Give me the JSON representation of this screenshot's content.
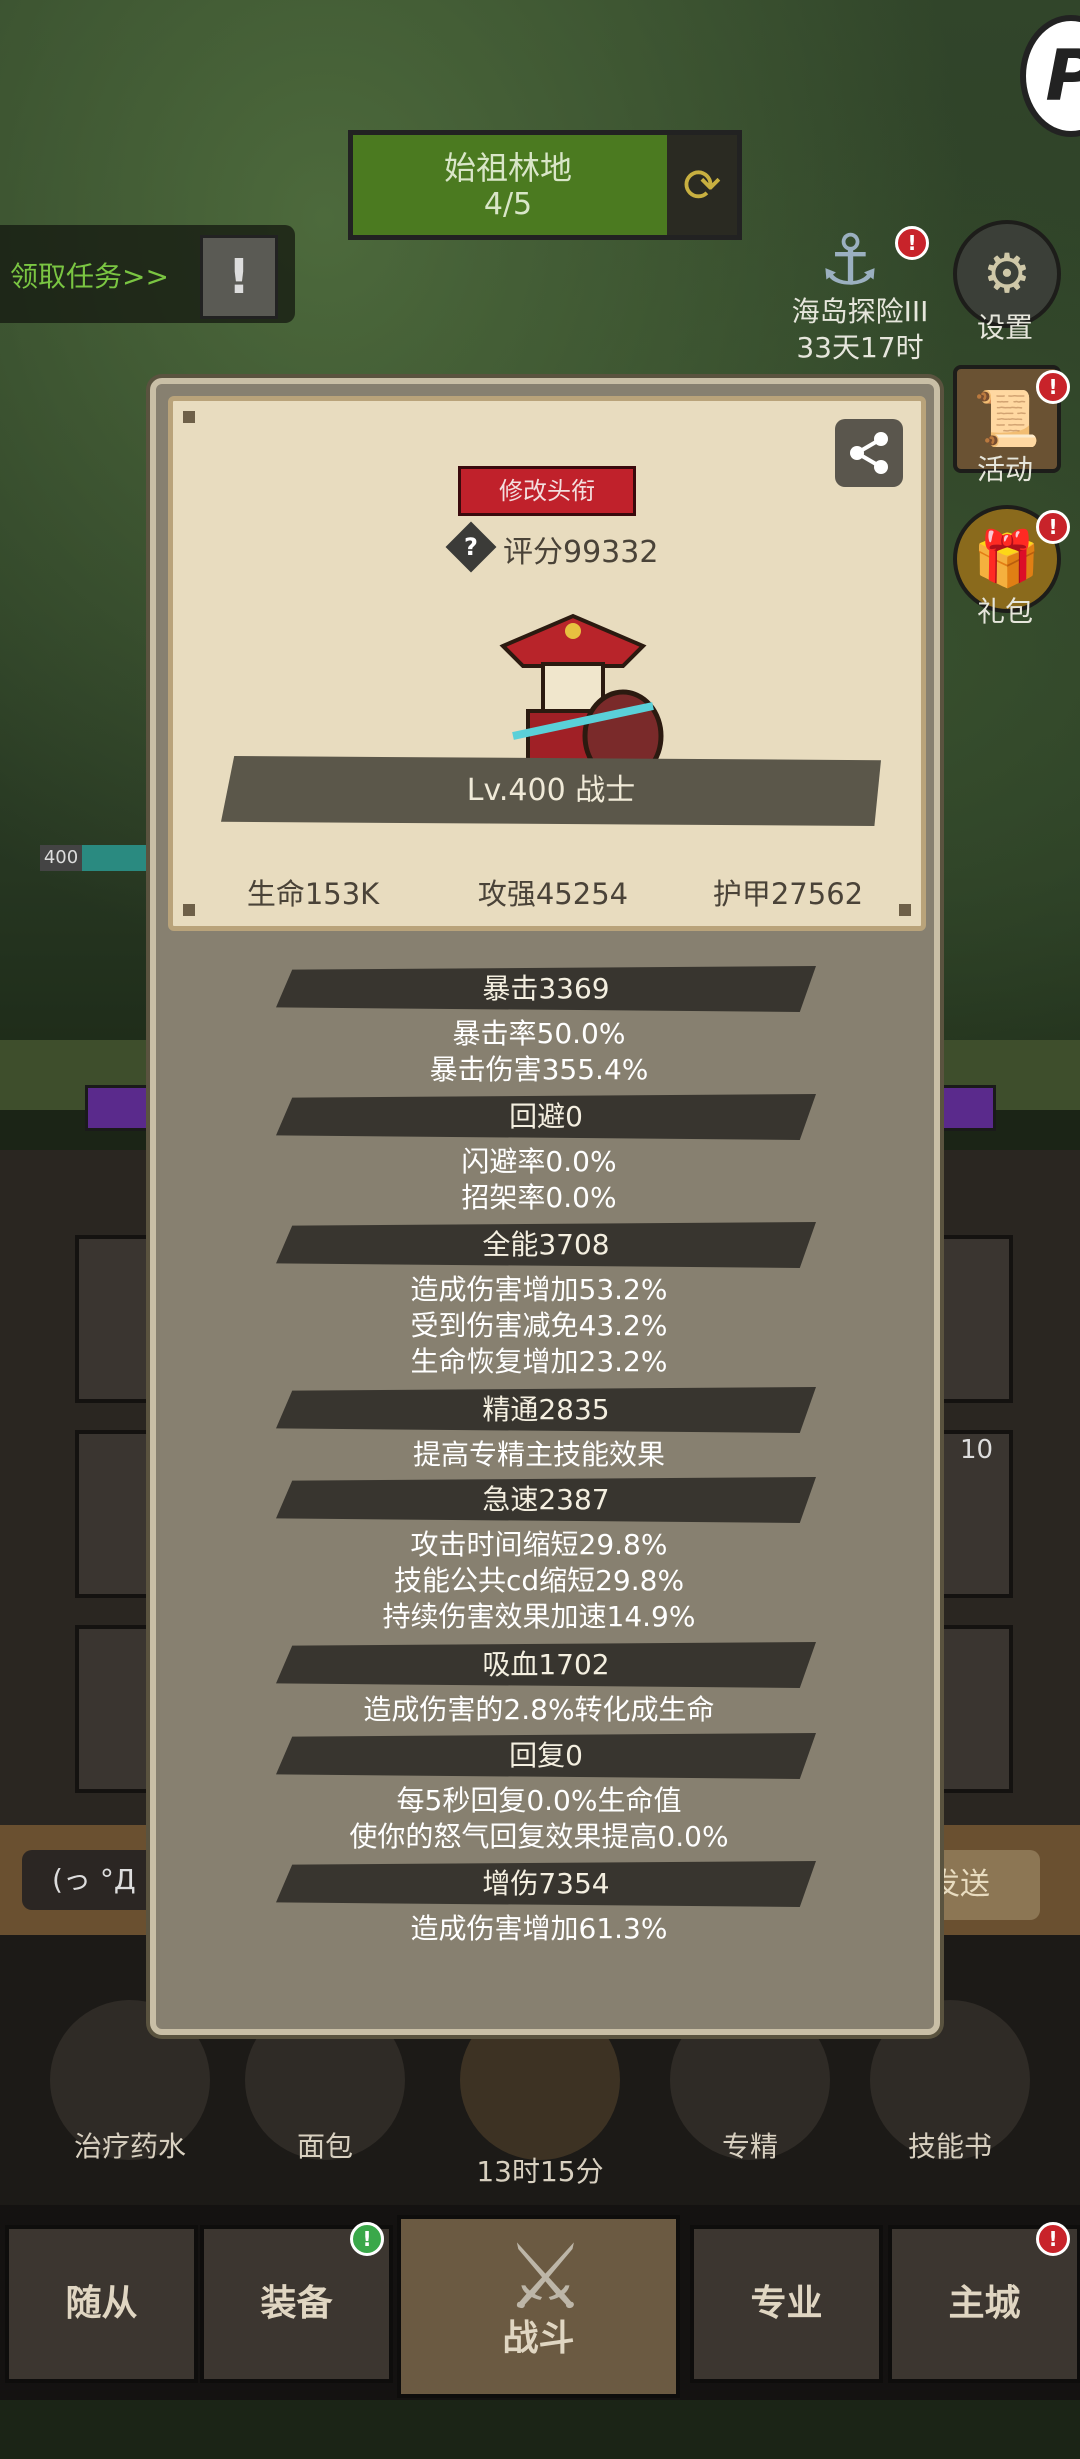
{
  "top_hud": {
    "region_name": "始祖林地",
    "region_progress": "4/5",
    "quest_label": "领取任务>>",
    "quest_icon": "!"
  },
  "side_menu": [
    {
      "label": "海岛探险III",
      "sub": "33天17时",
      "icon": "anchor-icon"
    },
    {
      "label": "设置",
      "icon": "gear-icon"
    },
    {
      "label": "活动",
      "icon": "scroll-icon"
    },
    {
      "label": "礼包",
      "icon": "gift-icon"
    }
  ],
  "profile": {
    "title_button": "修改头衔",
    "score": "评分99332",
    "level_class": "Lv.400 战士",
    "stats": [
      "生命153K",
      "攻强45254",
      "护甲27562"
    ]
  },
  "sections": [
    {
      "title": "暴击3369",
      "lines": [
        "暴击率50.0%",
        "暴击伤害355.4%"
      ]
    },
    {
      "title": "回避0",
      "lines": [
        "闪避率0.0%",
        "招架率0.0%"
      ]
    },
    {
      "title": "全能3708",
      "lines": [
        "造成伤害增加53.2%",
        "受到伤害减免43.2%",
        "生命恢复增加23.2%"
      ]
    },
    {
      "title": "精通2835",
      "lines": [
        "提高专精主技能效果"
      ]
    },
    {
      "title": "急速2387",
      "lines": [
        "攻击时间缩短29.8%",
        "技能公共cd缩短29.8%",
        "持续伤害效果加速14.9%"
      ]
    },
    {
      "title": "吸血1702",
      "lines": [
        "造成伤害的2.8%转化成生命"
      ]
    },
    {
      "title": "回复0",
      "lines": [
        "每5秒回复0.0%生命值",
        "使你的怒气回复效果提高0.0%"
      ]
    },
    {
      "title": "增伤7354",
      "lines": [
        "造成伤害增加61.3%"
      ]
    }
  ],
  "chat": {
    "input_text": "(っ °Д",
    "send_label": "发送"
  },
  "items": [
    {
      "label": "治疗药水"
    },
    {
      "label": "面包"
    },
    {
      "label": "13时15分"
    },
    {
      "label": "专精"
    },
    {
      "label": "技能书"
    }
  ],
  "tabs": [
    {
      "label": "随从"
    },
    {
      "label": "装备"
    },
    {
      "label": "战斗"
    },
    {
      "label": "专业"
    },
    {
      "label": "主城"
    }
  ],
  "misc": {
    "level_badge": "400",
    "slot_count": "10"
  },
  "colors": {
    "modal_bg": "#878070",
    "card_bg": "#e8dcbf",
    "title_button": "#c0212b",
    "section_banner": "#38352f"
  }
}
